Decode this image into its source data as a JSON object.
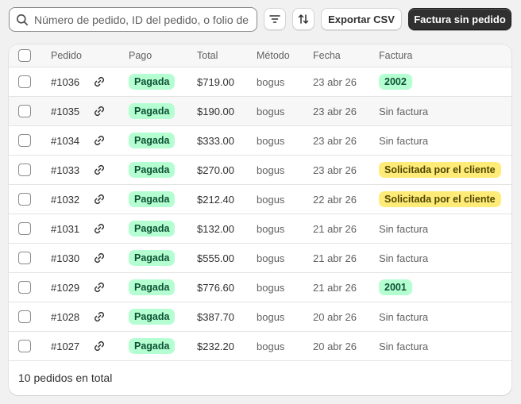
{
  "search": {
    "placeholder": "Número de pedido, ID del pedido, o folio de"
  },
  "toolbar": {
    "filter_icon": "filter-icon",
    "sort_icon": "sort-icon",
    "export_label": "Exportar CSV",
    "primary_label": "Factura sin pedido"
  },
  "table": {
    "headers": {
      "order": "Pedido",
      "payment": "Pago",
      "total": "Total",
      "method": "Método",
      "date": "Fecha",
      "invoice": "Factura"
    },
    "rows": [
      {
        "order": "#1036",
        "payment": "Pagada",
        "total": "$719.00",
        "method": "bogus",
        "date": "23 abr 26",
        "invoice": "2002",
        "invoice_style": "ok"
      },
      {
        "order": "#1035",
        "payment": "Pagada",
        "total": "$190.00",
        "method": "bogus",
        "date": "23 abr 26",
        "invoice": "Sin factura",
        "invoice_style": "none"
      },
      {
        "order": "#1034",
        "payment": "Pagada",
        "total": "$333.00",
        "method": "bogus",
        "date": "23 abr 26",
        "invoice": "Sin factura",
        "invoice_style": "none"
      },
      {
        "order": "#1033",
        "payment": "Pagada",
        "total": "$270.00",
        "method": "bogus",
        "date": "23 abr 26",
        "invoice": "Solicitada por el cliente",
        "invoice_style": "requested"
      },
      {
        "order": "#1032",
        "payment": "Pagada",
        "total": "$212.40",
        "method": "bogus",
        "date": "22 abr 26",
        "invoice": "Solicitada por el cliente",
        "invoice_style": "requested"
      },
      {
        "order": "#1031",
        "payment": "Pagada",
        "total": "$132.00",
        "method": "bogus",
        "date": "21 abr 26",
        "invoice": "Sin factura",
        "invoice_style": "none"
      },
      {
        "order": "#1030",
        "payment": "Pagada",
        "total": "$555.00",
        "method": "bogus",
        "date": "21 abr 26",
        "invoice": "Sin factura",
        "invoice_style": "none"
      },
      {
        "order": "#1029",
        "payment": "Pagada",
        "total": "$776.60",
        "method": "bogus",
        "date": "21 abr 26",
        "invoice": "2001",
        "invoice_style": "ok"
      },
      {
        "order": "#1028",
        "payment": "Pagada",
        "total": "$387.70",
        "method": "bogus",
        "date": "20 abr 26",
        "invoice": "Sin factura",
        "invoice_style": "none"
      },
      {
        "order": "#1027",
        "payment": "Pagada",
        "total": "$232.20",
        "method": "bogus",
        "date": "20 abr 26",
        "invoice": "Sin factura",
        "invoice_style": "none"
      }
    ],
    "footer": "10 pedidos en total"
  },
  "colors": {
    "paid_badge_bg": "#b4fed2",
    "requested_badge_bg": "#ffeb78",
    "primary_button_bg": "#303030"
  }
}
